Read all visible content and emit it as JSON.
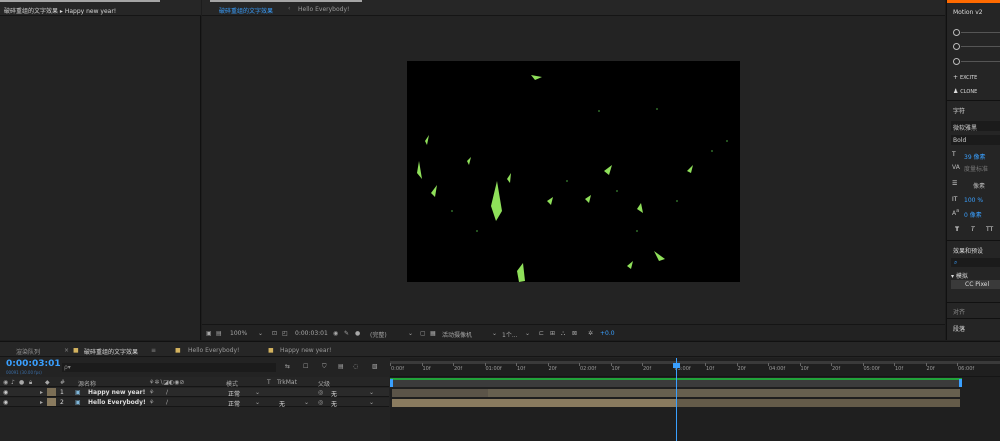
{
  "project_panel": {
    "tab_label": "破碎重组的文字效果 ▸ Happy new year!"
  },
  "viewer": {
    "tabs": [
      {
        "label": "破碎重组的文字效果"
      },
      {
        "separator": "‹"
      },
      {
        "label": "Hello Everybody!"
      }
    ],
    "toolbar": {
      "magnification": "100%",
      "timecode": "0:00:03:01",
      "resolution": "(完整)",
      "camera": "活动摄像机",
      "views": "1个...",
      "exposure": "+0.0"
    }
  },
  "right_panel": {
    "panel_title": "Motion v2",
    "excite_label": "EXCITE",
    "clone_label": "CLONE",
    "character_header": "字符",
    "font_name": "微软雅黑",
    "font_style": "Bold",
    "font_size": "39 像素",
    "leading_hint": "度量标准",
    "stroke_label": "像素",
    "scale_value": "100 %",
    "baseline_value": "0 像素",
    "effects_header": "效果和预设",
    "search_icon_glyph": "⌕",
    "tree_item": "▾ 模拟",
    "preset_item": "CC Pixel",
    "align_label": "对齐",
    "paragraph_label": "段落"
  },
  "timeline": {
    "tabs": [
      {
        "label": "渲染队列"
      },
      {
        "label": "破碎重组的文字效果"
      },
      {
        "label": "Hello Everybody!"
      },
      {
        "label": "Happy new year!"
      }
    ],
    "current_time": "0:00:03:01",
    "frame_info": "00091 (30.00 fps)",
    "search_placeholder": "ρ▾",
    "columns": {
      "source_name": "源名称",
      "mode": "模式",
      "t": "T",
      "trkmat": "TrkMat",
      "parent": "父级"
    },
    "layers": [
      {
        "index": "1",
        "name": "Happy new year!",
        "mode": "正常",
        "trkmat": "",
        "parent": "无"
      },
      {
        "index": "2",
        "name": "Hello Everybody!",
        "mode": "正常",
        "trkmat": "无",
        "parent": "无"
      }
    ],
    "ruler_labels": [
      "0:00f",
      "10f",
      "20f",
      "01:00f",
      "10f",
      "20f",
      "02:00f",
      "10f",
      "20f",
      "03:00f",
      "10f",
      "20f",
      "04:00f",
      "10f",
      "20f",
      "05:00f",
      "10f",
      "20f",
      "06:00f"
    ],
    "playhead_time": "03:01"
  },
  "colors": {
    "accent_blue": "#3aa0ff",
    "work_bar": "#3a3a3a",
    "track_green": "#21a33a",
    "layer1_bar": "#7b6e55",
    "layer2_bar": "#8a7b5f",
    "shard_green": "#8fe05a",
    "accent_orange": "#ff6a00"
  }
}
